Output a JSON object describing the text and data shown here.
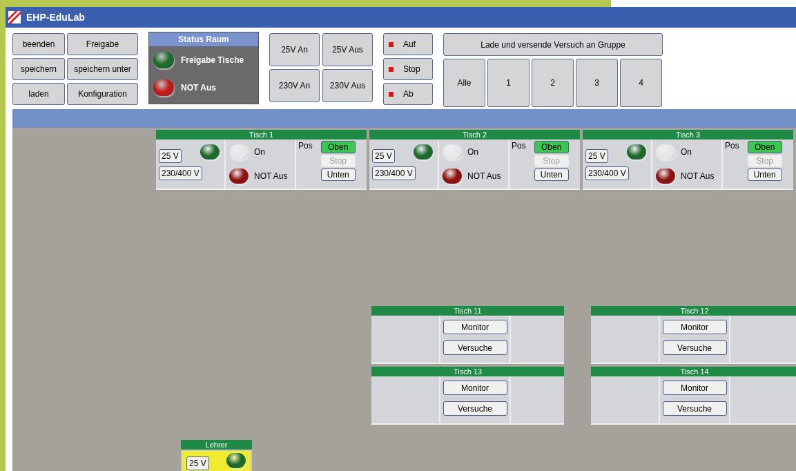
{
  "window": {
    "title": "EHP-EduLab"
  },
  "file_buttons": [
    "beenden",
    "Freigabe",
    "speichern",
    "speichern unter",
    "laden",
    "Konfiguration"
  ],
  "status_room": {
    "title": "Status Raum",
    "indicators": [
      {
        "label": "Freigabe Tische",
        "color": "#1d6a2c"
      },
      {
        "label": "NOT Aus",
        "color": "#c01a1a"
      }
    ]
  },
  "power_buttons": [
    "25V An",
    "25V Aus",
    "230V An",
    "230V Aus"
  ],
  "motion_buttons": [
    {
      "label": "Auf",
      "color": "#e01414"
    },
    {
      "label": "Stop",
      "color": "#e01414"
    },
    {
      "label": "Ab",
      "color": "#e01414"
    }
  ],
  "group_send": {
    "label": "Lade und versende Versuch an Gruppe",
    "targets": [
      "Alle",
      "1",
      "2",
      "3",
      "4"
    ]
  },
  "tables": [
    {
      "kind": "control",
      "title": "Tisch 1",
      "voltage_buttons": [
        "25 V",
        "230/400 V"
      ],
      "voltage_lamp": {
        "color": "#1d6a2c"
      },
      "lamps": [
        {
          "label": "On",
          "color": "#e6e6e6"
        },
        {
          "label": "NOT Aus",
          "color": "#8c1212"
        }
      ],
      "pos": {
        "label": "Pos",
        "buttons": [
          {
            "label": "Oben",
            "selected": true,
            "disabled": false
          },
          {
            "label": "Stop",
            "selected": false,
            "disabled": true
          },
          {
            "label": "Unten",
            "selected": false,
            "disabled": false
          }
        ]
      }
    },
    {
      "kind": "control",
      "title": "Tisch 2",
      "voltage_buttons": [
        "25 V",
        "230/400 V"
      ],
      "voltage_lamp": {
        "color": "#1d6a2c"
      },
      "lamps": [
        {
          "label": "On",
          "color": "#e6e6e6"
        },
        {
          "label": "NOT Aus",
          "color": "#8c1212"
        }
      ],
      "pos": {
        "label": "Pos",
        "buttons": [
          {
            "label": "Oben",
            "selected": true,
            "disabled": false
          },
          {
            "label": "Stop",
            "selected": false,
            "disabled": true
          },
          {
            "label": "Unten",
            "selected": false,
            "disabled": false
          }
        ]
      }
    },
    {
      "kind": "control",
      "title": "Tisch 3",
      "voltage_buttons": [
        "25 V",
        "230/400 V"
      ],
      "voltage_lamp": {
        "color": "#1d6a2c"
      },
      "lamps": [
        {
          "label": "On",
          "color": "#e6e6e6"
        },
        {
          "label": "NOT Aus",
          "color": "#8c1212"
        }
      ],
      "pos": {
        "label": "Pos",
        "buttons": [
          {
            "label": "Oben",
            "selected": true,
            "disabled": false
          },
          {
            "label": "Stop",
            "selected": false,
            "disabled": true
          },
          {
            "label": "Unten",
            "selected": false,
            "disabled": false
          }
        ]
      }
    },
    {
      "kind": "monitor",
      "title": "Tisch 11",
      "buttons": [
        "Monitor",
        "Versuche"
      ]
    },
    {
      "kind": "monitor",
      "title": "Tisch 12",
      "buttons": [
        "Monitor",
        "Versuche"
      ]
    },
    {
      "kind": "monitor",
      "title": "Tisch 13",
      "buttons": [
        "Monitor",
        "Versuche"
      ]
    },
    {
      "kind": "monitor",
      "title": "Tisch 14",
      "buttons": [
        "Monitor",
        "Versuche"
      ]
    },
    {
      "kind": "teacher",
      "title": "Lehrer",
      "voltage_buttons": [
        "25 V"
      ],
      "voltage_lamp": {
        "color": "#1d6a2c"
      }
    }
  ]
}
